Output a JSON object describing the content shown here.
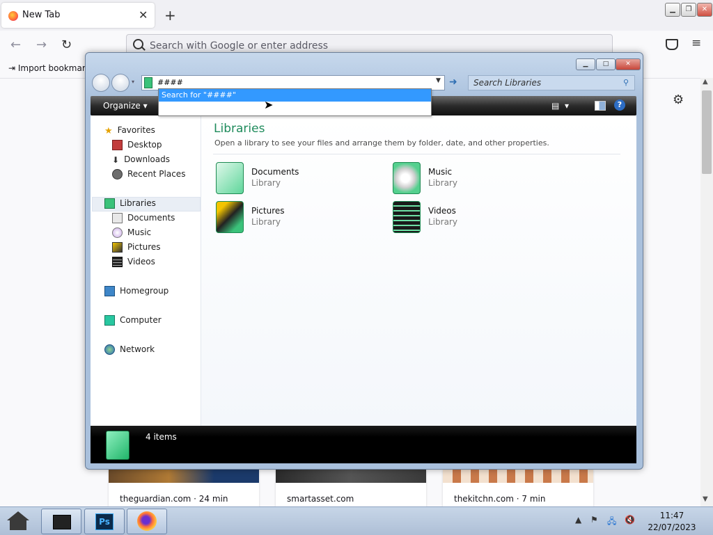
{
  "firefox": {
    "tab_title": "New Tab",
    "urlbar_placeholder": "Search with Google or enter address",
    "bookmark_import": "Import bookmark",
    "new_tab_symbol": "+",
    "close_symbol": "✕"
  },
  "top_sites": [
    {
      "label": "theguardian.com · 24 min"
    },
    {
      "label": "smartasset.com"
    },
    {
      "label": "thekitchn.com · 7 min"
    }
  ],
  "explorer": {
    "address_value": "####",
    "search_placeholder": "Search Libraries",
    "suggestion": "Search for \"####\"",
    "toolbar": {
      "organize": "Organize ▾"
    },
    "nav": {
      "favorites": {
        "label": "Favorites",
        "children": [
          "Desktop",
          "Downloads",
          "Recent Places"
        ]
      },
      "libraries": {
        "label": "Libraries",
        "children": [
          "Documents",
          "Music",
          "Pictures",
          "Videos"
        ]
      },
      "homegroup": "Homegroup",
      "computer": "Computer",
      "network": "Network"
    },
    "main": {
      "heading": "Libraries",
      "subtext": "Open a library to see your files and arrange them by folder, date, and other properties.",
      "libraries": [
        {
          "name": "Documents",
          "kind": "Library"
        },
        {
          "name": "Music",
          "kind": "Library"
        },
        {
          "name": "Pictures",
          "kind": "Library"
        },
        {
          "name": "Videos",
          "kind": "Library"
        }
      ]
    },
    "status": {
      "count": "4 items"
    }
  },
  "taskbar": {
    "ps_label": "Ps",
    "time": "11:47",
    "date": "22/07/2023"
  }
}
